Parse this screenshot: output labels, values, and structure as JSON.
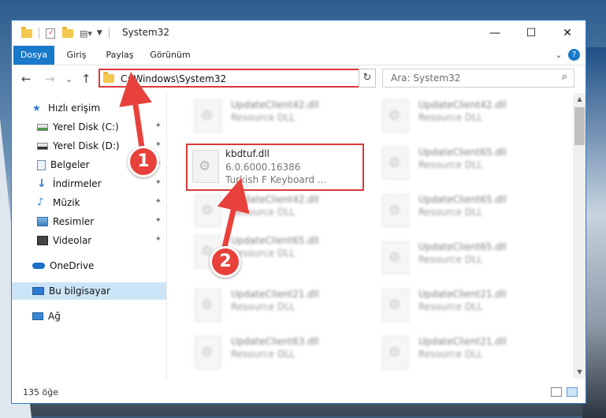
{
  "window": {
    "title": "System32",
    "controls": {
      "minimize": "—",
      "maximize": "☐",
      "close": "✕"
    }
  },
  "ribbon": {
    "tabs": [
      "Dosya",
      "Giriş",
      "Paylaş",
      "Görünüm"
    ],
    "expand": "⌄",
    "help": "?"
  },
  "nav": {
    "back": "←",
    "forward": "→",
    "recent": "⌄",
    "up": "↑",
    "address": "C:\\Windows\\System32",
    "address_dropdown": "⌄",
    "refresh": "↻",
    "search_placeholder": "Ara: System32",
    "search_icon": "⌕"
  },
  "sidebar": {
    "items": [
      {
        "label": "Hızlı erişim",
        "icon": "star-icon",
        "pinned": false
      },
      {
        "label": "Yerel Disk (C:)",
        "icon": "drive-icon",
        "pinned": true
      },
      {
        "label": "Yerel Disk (D:)",
        "icon": "drive-icon",
        "pinned": true
      },
      {
        "label": "Belgeler",
        "icon": "documents-icon",
        "pinned": true
      },
      {
        "label": "İndirmeler",
        "icon": "download-icon",
        "pinned": true
      },
      {
        "label": "Müzik",
        "icon": "music-icon",
        "pinned": true
      },
      {
        "label": "Resimler",
        "icon": "pictures-icon",
        "pinned": true
      },
      {
        "label": "Videolar",
        "icon": "videos-icon",
        "pinned": true
      },
      {
        "label": "OneDrive",
        "icon": "onedrive-icon",
        "pinned": false
      },
      {
        "label": "Bu bilgisayar",
        "icon": "computer-icon",
        "pinned": false,
        "selected": true
      },
      {
        "label": "Ağ",
        "icon": "network-icon",
        "pinned": false
      }
    ],
    "pin_glyph": "📌"
  },
  "files": {
    "highlighted": {
      "name": "kbdtuf.dll",
      "version": "6.0.6000.16386",
      "description": "Turkish F Keyboard ..."
    },
    "blurred_left": [
      {
        "name": "UpdateClient42.dll",
        "type": "Resource DLL"
      },
      {
        "name": "UpdateClient42.dll",
        "type": "Resource DLL"
      },
      {
        "name": "UpdateClient65.dll",
        "type": "Resource DLL"
      },
      {
        "name": "UpdateClient21.dll",
        "type": "Resource DLL"
      },
      {
        "name": "UpdateClient63.dll",
        "type": "Resource DLL"
      }
    ],
    "blurred_right": [
      {
        "name": "UpdateClient42.dll",
        "type": "Resource DLL"
      },
      {
        "name": "UpdateClient65.dll",
        "type": "Resource DLL"
      },
      {
        "name": "UpdateClient65.dll",
        "type": "Resource DLL"
      },
      {
        "name": "UpdateClient65.dll",
        "type": "Resource DLL"
      },
      {
        "name": "UpdateClient21.dll",
        "type": "Resource DLL"
      },
      {
        "name": "UpdateClient21.dll",
        "type": "Resource DLL"
      }
    ]
  },
  "status": {
    "count": "135 öğe"
  },
  "annotations": {
    "step1": "1",
    "step2": "2",
    "color": "#e8413b"
  }
}
